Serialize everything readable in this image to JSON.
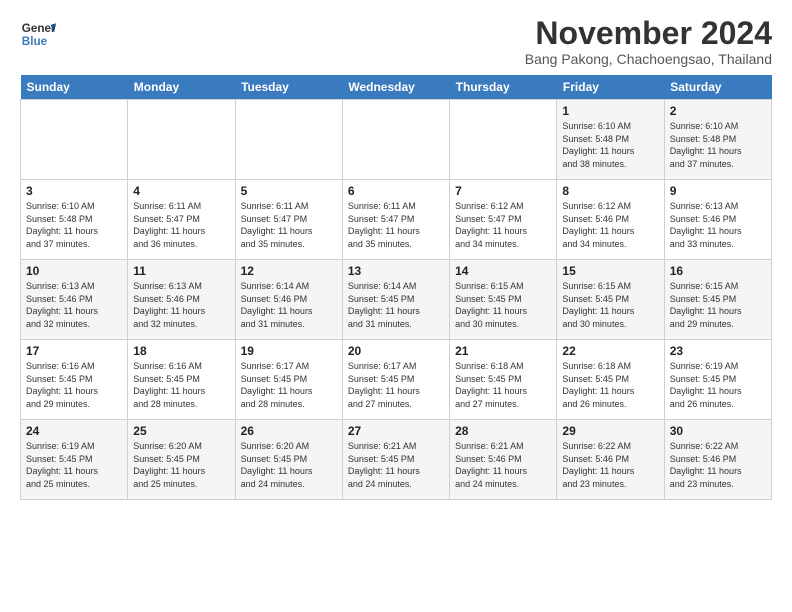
{
  "logo": {
    "line1": "General",
    "line2": "Blue"
  },
  "title": "November 2024",
  "subtitle": "Bang Pakong, Chachoengsao, Thailand",
  "days_of_week": [
    "Sunday",
    "Monday",
    "Tuesday",
    "Wednesday",
    "Thursday",
    "Friday",
    "Saturday"
  ],
  "weeks": [
    [
      {
        "day": "",
        "info": ""
      },
      {
        "day": "",
        "info": ""
      },
      {
        "day": "",
        "info": ""
      },
      {
        "day": "",
        "info": ""
      },
      {
        "day": "",
        "info": ""
      },
      {
        "day": "1",
        "info": "Sunrise: 6:10 AM\nSunset: 5:48 PM\nDaylight: 11 hours\nand 38 minutes."
      },
      {
        "day": "2",
        "info": "Sunrise: 6:10 AM\nSunset: 5:48 PM\nDaylight: 11 hours\nand 37 minutes."
      }
    ],
    [
      {
        "day": "3",
        "info": "Sunrise: 6:10 AM\nSunset: 5:48 PM\nDaylight: 11 hours\nand 37 minutes."
      },
      {
        "day": "4",
        "info": "Sunrise: 6:11 AM\nSunset: 5:47 PM\nDaylight: 11 hours\nand 36 minutes."
      },
      {
        "day": "5",
        "info": "Sunrise: 6:11 AM\nSunset: 5:47 PM\nDaylight: 11 hours\nand 35 minutes."
      },
      {
        "day": "6",
        "info": "Sunrise: 6:11 AM\nSunset: 5:47 PM\nDaylight: 11 hours\nand 35 minutes."
      },
      {
        "day": "7",
        "info": "Sunrise: 6:12 AM\nSunset: 5:47 PM\nDaylight: 11 hours\nand 34 minutes."
      },
      {
        "day": "8",
        "info": "Sunrise: 6:12 AM\nSunset: 5:46 PM\nDaylight: 11 hours\nand 34 minutes."
      },
      {
        "day": "9",
        "info": "Sunrise: 6:13 AM\nSunset: 5:46 PM\nDaylight: 11 hours\nand 33 minutes."
      }
    ],
    [
      {
        "day": "10",
        "info": "Sunrise: 6:13 AM\nSunset: 5:46 PM\nDaylight: 11 hours\nand 32 minutes."
      },
      {
        "day": "11",
        "info": "Sunrise: 6:13 AM\nSunset: 5:46 PM\nDaylight: 11 hours\nand 32 minutes."
      },
      {
        "day": "12",
        "info": "Sunrise: 6:14 AM\nSunset: 5:46 PM\nDaylight: 11 hours\nand 31 minutes."
      },
      {
        "day": "13",
        "info": "Sunrise: 6:14 AM\nSunset: 5:45 PM\nDaylight: 11 hours\nand 31 minutes."
      },
      {
        "day": "14",
        "info": "Sunrise: 6:15 AM\nSunset: 5:45 PM\nDaylight: 11 hours\nand 30 minutes."
      },
      {
        "day": "15",
        "info": "Sunrise: 6:15 AM\nSunset: 5:45 PM\nDaylight: 11 hours\nand 30 minutes."
      },
      {
        "day": "16",
        "info": "Sunrise: 6:15 AM\nSunset: 5:45 PM\nDaylight: 11 hours\nand 29 minutes."
      }
    ],
    [
      {
        "day": "17",
        "info": "Sunrise: 6:16 AM\nSunset: 5:45 PM\nDaylight: 11 hours\nand 29 minutes."
      },
      {
        "day": "18",
        "info": "Sunrise: 6:16 AM\nSunset: 5:45 PM\nDaylight: 11 hours\nand 28 minutes."
      },
      {
        "day": "19",
        "info": "Sunrise: 6:17 AM\nSunset: 5:45 PM\nDaylight: 11 hours\nand 28 minutes."
      },
      {
        "day": "20",
        "info": "Sunrise: 6:17 AM\nSunset: 5:45 PM\nDaylight: 11 hours\nand 27 minutes."
      },
      {
        "day": "21",
        "info": "Sunrise: 6:18 AM\nSunset: 5:45 PM\nDaylight: 11 hours\nand 27 minutes."
      },
      {
        "day": "22",
        "info": "Sunrise: 6:18 AM\nSunset: 5:45 PM\nDaylight: 11 hours\nand 26 minutes."
      },
      {
        "day": "23",
        "info": "Sunrise: 6:19 AM\nSunset: 5:45 PM\nDaylight: 11 hours\nand 26 minutes."
      }
    ],
    [
      {
        "day": "24",
        "info": "Sunrise: 6:19 AM\nSunset: 5:45 PM\nDaylight: 11 hours\nand 25 minutes."
      },
      {
        "day": "25",
        "info": "Sunrise: 6:20 AM\nSunset: 5:45 PM\nDaylight: 11 hours\nand 25 minutes."
      },
      {
        "day": "26",
        "info": "Sunrise: 6:20 AM\nSunset: 5:45 PM\nDaylight: 11 hours\nand 24 minutes."
      },
      {
        "day": "27",
        "info": "Sunrise: 6:21 AM\nSunset: 5:45 PM\nDaylight: 11 hours\nand 24 minutes."
      },
      {
        "day": "28",
        "info": "Sunrise: 6:21 AM\nSunset: 5:46 PM\nDaylight: 11 hours\nand 24 minutes."
      },
      {
        "day": "29",
        "info": "Sunrise: 6:22 AM\nSunset: 5:46 PM\nDaylight: 11 hours\nand 23 minutes."
      },
      {
        "day": "30",
        "info": "Sunrise: 6:22 AM\nSunset: 5:46 PM\nDaylight: 11 hours\nand 23 minutes."
      }
    ]
  ]
}
